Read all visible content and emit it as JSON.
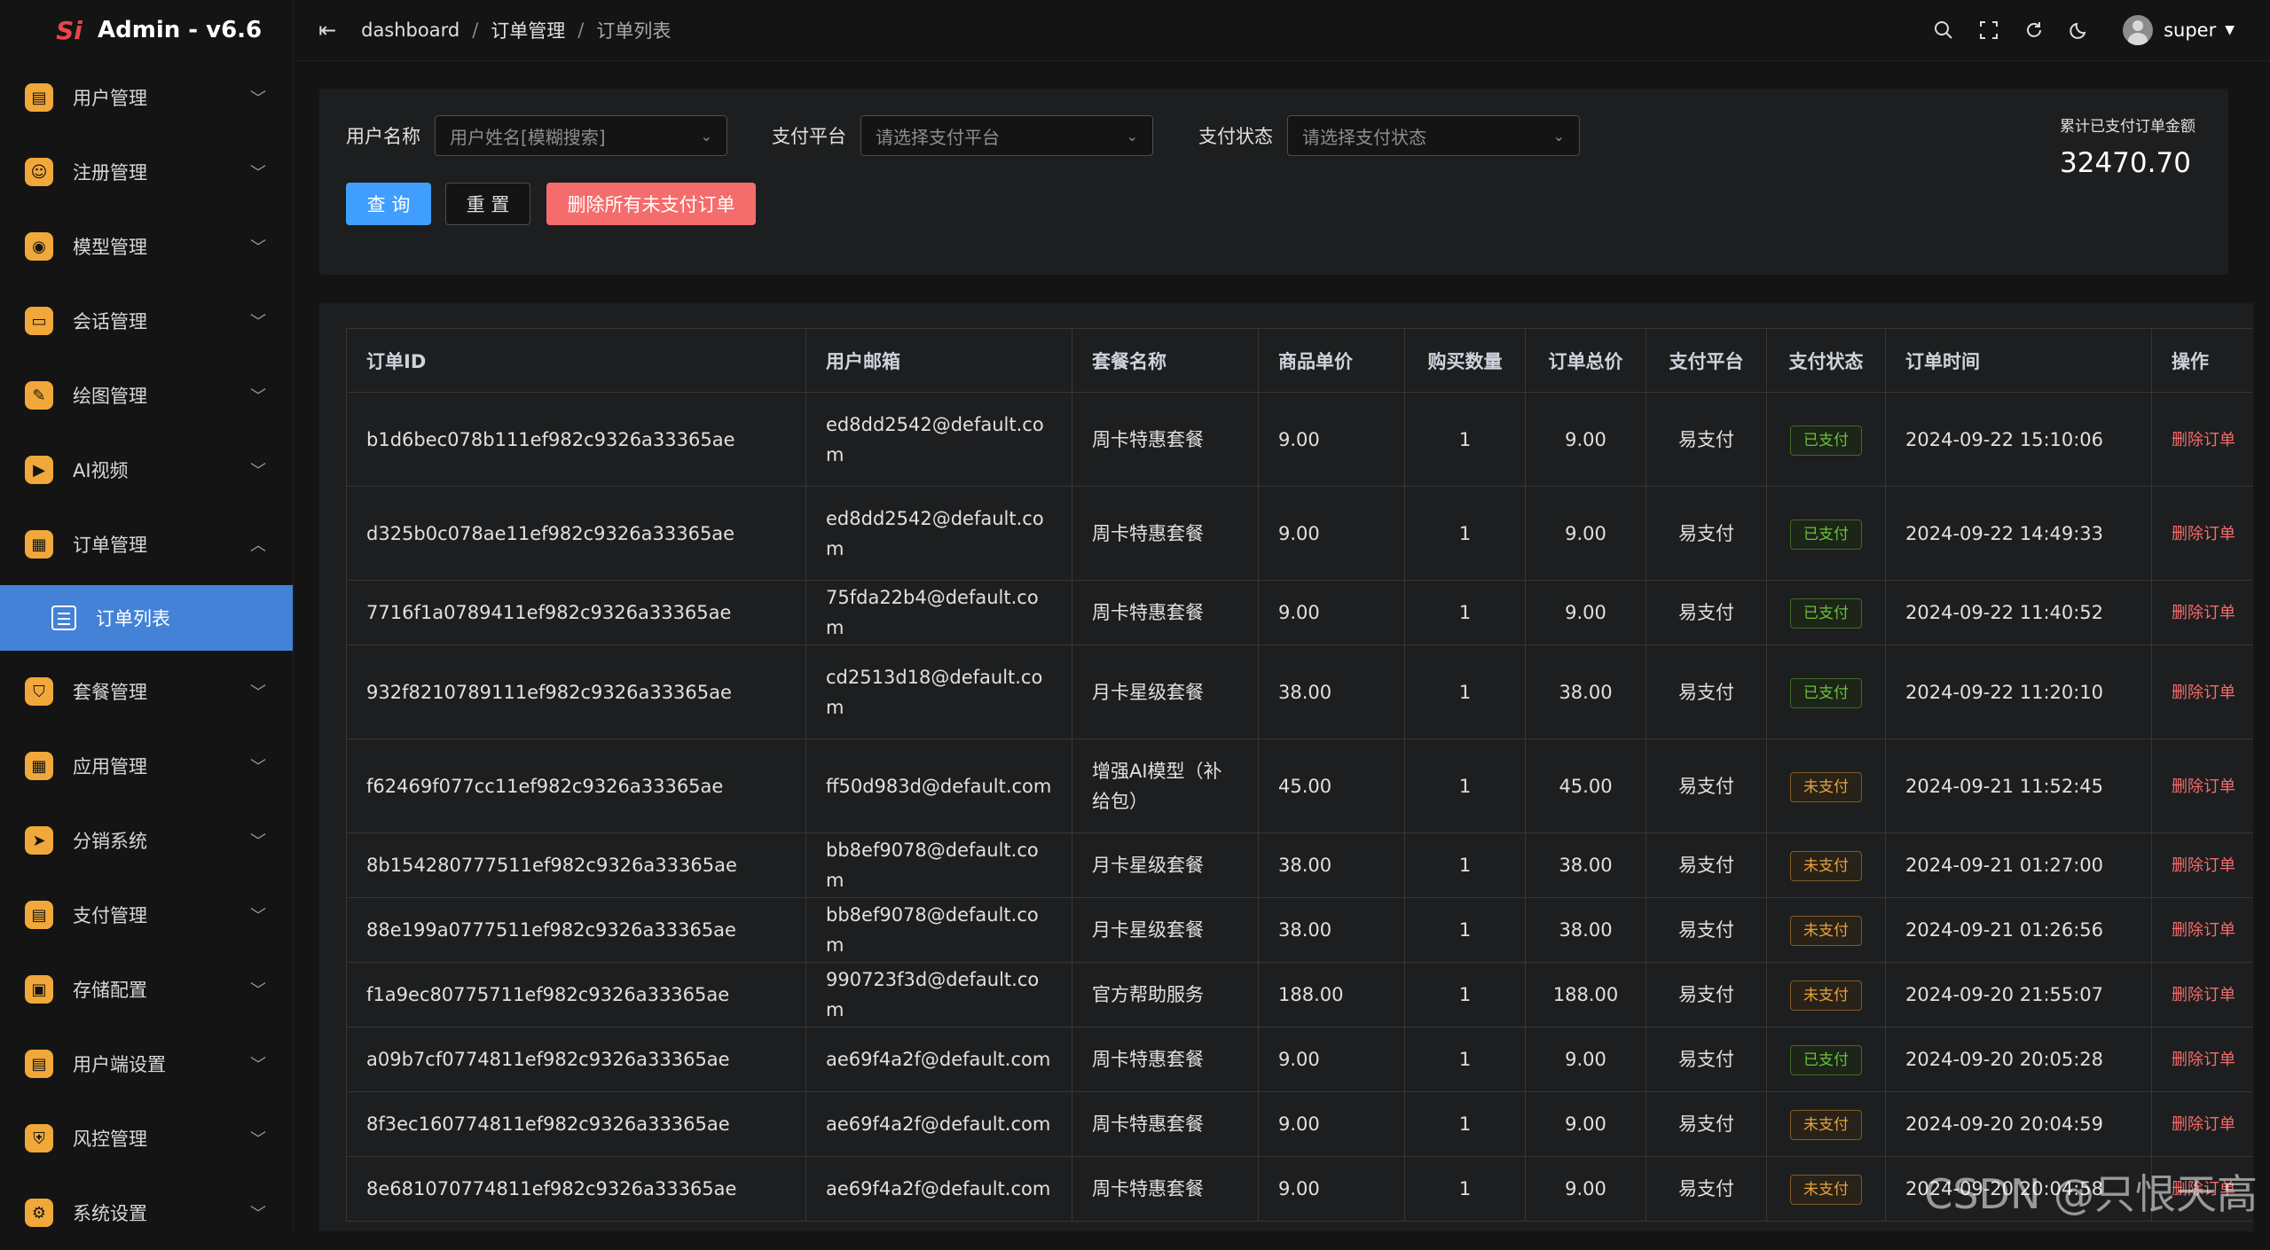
{
  "app": {
    "title": "Admin - v6.6",
    "logo_text": "Si"
  },
  "sidebar": {
    "items": [
      {
        "label": "用户管理",
        "icon": "user-card-icon",
        "color": "#f0a83a"
      },
      {
        "label": "注册管理",
        "icon": "register-icon",
        "color": "#f0a83a"
      },
      {
        "label": "模型管理",
        "icon": "model-icon",
        "color": "#f0a83a"
      },
      {
        "label": "会话管理",
        "icon": "chat-icon",
        "color": "#f0a83a"
      },
      {
        "label": "绘图管理",
        "icon": "palette-icon",
        "color": "#f0a83a"
      },
      {
        "label": "AI视频",
        "icon": "video-icon",
        "color": "#f0a83a"
      },
      {
        "label": "订单管理",
        "icon": "order-icon",
        "color": "#f0a83a",
        "expanded": true
      },
      {
        "label": "套餐管理",
        "icon": "package-icon",
        "color": "#f0a83a"
      },
      {
        "label": "应用管理",
        "icon": "apps-icon",
        "color": "#f0a83a"
      },
      {
        "label": "分销系统",
        "icon": "share-icon",
        "color": "#f0a83a"
      },
      {
        "label": "支付管理",
        "icon": "payment-icon",
        "color": "#f0a83a"
      },
      {
        "label": "存储配置",
        "icon": "storage-icon",
        "color": "#f0a83a"
      },
      {
        "label": "用户端设置",
        "icon": "client-settings-icon",
        "color": "#f0a83a"
      },
      {
        "label": "风控管理",
        "icon": "shield-icon",
        "color": "#f0a83a"
      },
      {
        "label": "系统设置",
        "icon": "gear-icon",
        "color": "#f0a83a"
      }
    ],
    "active_sub": "订单列表"
  },
  "header": {
    "breadcrumb": [
      "dashboard",
      "订单管理",
      "订单列表"
    ],
    "user": "super"
  },
  "filters": {
    "username_label": "用户名称",
    "username_placeholder": "用户姓名[模糊搜索]",
    "platform_label": "支付平台",
    "platform_placeholder": "请选择支付平台",
    "status_label": "支付状态",
    "status_placeholder": "请选择支付状态",
    "query_btn": "查 询",
    "reset_btn": "重 置",
    "delete_btn": "删除所有未支付订单",
    "stat_label": "累计已支付订单金额",
    "stat_value": "32470.70"
  },
  "table": {
    "columns": [
      "订单ID",
      "用户邮箱",
      "套餐名称",
      "商品单价",
      "购买数量",
      "订单总价",
      "支付平台",
      "支付状态",
      "订单时间",
      "操作"
    ],
    "rows": [
      {
        "id": "b1d6bec078b111ef982c9326a33365ae",
        "email": "ed8dd2542@default.com",
        "pkg": "周卡特惠套餐",
        "price": "9.00",
        "qty": "1",
        "total": "9.00",
        "platform": "易支付",
        "status": "已支付",
        "paid": true,
        "time": "2024-09-22 15:10:06",
        "action": "删除订单",
        "tall": true
      },
      {
        "id": "d325b0c078ae11ef982c9326a33365ae",
        "email": "ed8dd2542@default.com",
        "pkg": "周卡特惠套餐",
        "price": "9.00",
        "qty": "1",
        "total": "9.00",
        "platform": "易支付",
        "status": "已支付",
        "paid": true,
        "time": "2024-09-22 14:49:33",
        "action": "删除订单",
        "tall": true
      },
      {
        "id": "7716f1a0789411ef982c9326a33365ae",
        "email": "75fda22b4@default.com",
        "pkg": "周卡特惠套餐",
        "price": "9.00",
        "qty": "1",
        "total": "9.00",
        "platform": "易支付",
        "status": "已支付",
        "paid": true,
        "time": "2024-09-22 11:40:52",
        "action": "删除订单",
        "tall": false
      },
      {
        "id": "932f8210789111ef982c9326a33365ae",
        "email": "cd2513d18@default.com",
        "pkg": "月卡星级套餐",
        "price": "38.00",
        "qty": "1",
        "total": "38.00",
        "platform": "易支付",
        "status": "已支付",
        "paid": true,
        "time": "2024-09-22 11:20:10",
        "action": "删除订单",
        "tall": true
      },
      {
        "id": "f62469f077cc11ef982c9326a33365ae",
        "email": "ff50d983d@default.com",
        "pkg": "增强AI模型（补给包）",
        "price": "45.00",
        "qty": "1",
        "total": "45.00",
        "platform": "易支付",
        "status": "未支付",
        "paid": false,
        "time": "2024-09-21 11:52:45",
        "action": "删除订单",
        "tall": true
      },
      {
        "id": "8b154280777511ef982c9326a33365ae",
        "email": "bb8ef9078@default.com",
        "pkg": "月卡星级套餐",
        "price": "38.00",
        "qty": "1",
        "total": "38.00",
        "platform": "易支付",
        "status": "未支付",
        "paid": false,
        "time": "2024-09-21 01:27:00",
        "action": "删除订单",
        "tall": false
      },
      {
        "id": "88e199a0777511ef982c9326a33365ae",
        "email": "bb8ef9078@default.com",
        "pkg": "月卡星级套餐",
        "price": "38.00",
        "qty": "1",
        "total": "38.00",
        "platform": "易支付",
        "status": "未支付",
        "paid": false,
        "time": "2024-09-21 01:26:56",
        "action": "删除订单",
        "tall": false
      },
      {
        "id": "f1a9ec80775711ef982c9326a33365ae",
        "email": "990723f3d@default.com",
        "pkg": "官方帮助服务",
        "price": "188.00",
        "qty": "1",
        "total": "188.00",
        "platform": "易支付",
        "status": "未支付",
        "paid": false,
        "time": "2024-09-20 21:55:07",
        "action": "删除订单",
        "tall": false
      },
      {
        "id": "a09b7cf0774811ef982c9326a33365ae",
        "email": "ae69f4a2f@default.com",
        "pkg": "周卡特惠套餐",
        "price": "9.00",
        "qty": "1",
        "total": "9.00",
        "platform": "易支付",
        "status": "已支付",
        "paid": true,
        "time": "2024-09-20 20:05:28",
        "action": "删除订单",
        "tall": false
      },
      {
        "id": "8f3ec160774811ef982c9326a33365ae",
        "email": "ae69f4a2f@default.com",
        "pkg": "周卡特惠套餐",
        "price": "9.00",
        "qty": "1",
        "total": "9.00",
        "platform": "易支付",
        "status": "未支付",
        "paid": false,
        "time": "2024-09-20 20:04:59",
        "action": "删除订单",
        "tall": false
      },
      {
        "id": "8e681070774811ef982c9326a33365ae",
        "email": "ae69f4a2f@default.com",
        "pkg": "周卡特惠套餐",
        "price": "9.00",
        "qty": "1",
        "total": "9.00",
        "platform": "易支付",
        "status": "未支付",
        "paid": false,
        "time": "2024-09-20 20:04:58",
        "action": "删除订单",
        "tall": false
      }
    ]
  },
  "watermark": "CSDN @只恨天高"
}
